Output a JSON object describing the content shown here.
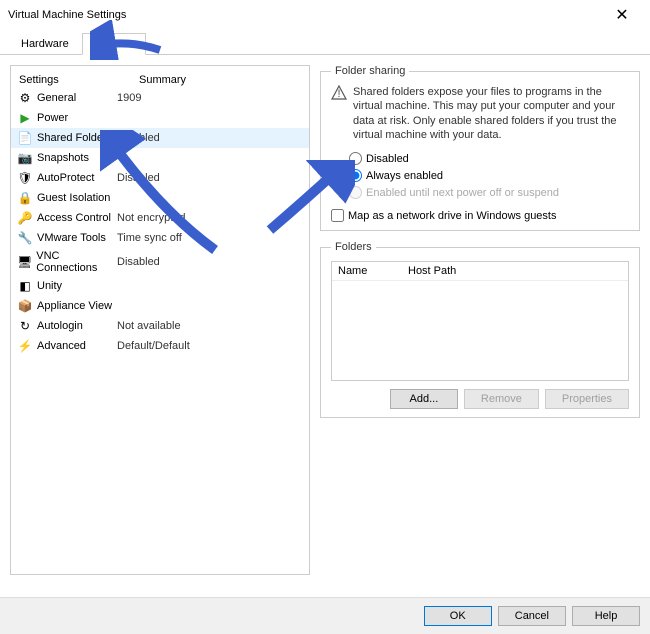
{
  "window": {
    "title": "Virtual Machine Settings"
  },
  "tabs": {
    "hardware": "Hardware",
    "options": "Options"
  },
  "listHeaders": {
    "settings": "Settings",
    "summary": "Summary"
  },
  "settings": [
    {
      "icon": "gear-icon",
      "label": "General",
      "summary": "1909"
    },
    {
      "icon": "play-icon",
      "label": "Power",
      "summary": ""
    },
    {
      "icon": "folder-icon",
      "label": "Shared Folders",
      "summary": "Disabled"
    },
    {
      "icon": "camera-icon",
      "label": "Snapshots",
      "summary": ""
    },
    {
      "icon": "shield-icon",
      "label": "AutoProtect",
      "summary": "Disabled"
    },
    {
      "icon": "lock-icon",
      "label": "Guest Isolation",
      "summary": ""
    },
    {
      "icon": "key-icon",
      "label": "Access Control",
      "summary": "Not encrypted"
    },
    {
      "icon": "tools-icon",
      "label": "VMware Tools",
      "summary": "Time sync off"
    },
    {
      "icon": "vnc-icon",
      "label": "VNC Connections",
      "summary": "Disabled"
    },
    {
      "icon": "unity-icon",
      "label": "Unity",
      "summary": ""
    },
    {
      "icon": "appliance-icon",
      "label": "Appliance View",
      "summary": ""
    },
    {
      "icon": "autologin-icon",
      "label": "Autologin",
      "summary": "Not available"
    },
    {
      "icon": "advanced-icon",
      "label": "Advanced",
      "summary": "Default/Default"
    }
  ],
  "folderSharing": {
    "legend": "Folder sharing",
    "warning": "Shared folders expose your files to programs in the virtual machine. This may put your computer and your data at risk. Only enable shared folders if you trust the virtual machine with your data.",
    "radioDisabled": "Disabled",
    "radioAlways": "Always enabled",
    "radioPowerOff": "Enabled until next power off or suspend",
    "mapDrive": "Map as a network drive in Windows guests"
  },
  "folders": {
    "legend": "Folders",
    "colName": "Name",
    "colHostPath": "Host Path",
    "btnAdd": "Add...",
    "btnRemove": "Remove",
    "btnProperties": "Properties"
  },
  "buttons": {
    "ok": "OK",
    "cancel": "Cancel",
    "help": "Help"
  }
}
